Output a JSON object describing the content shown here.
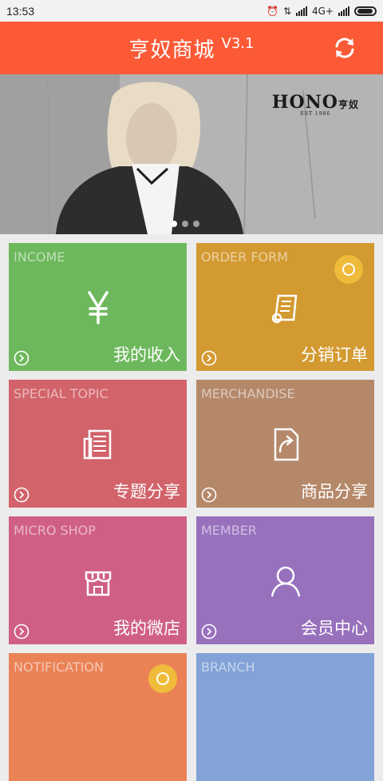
{
  "status_bar": {
    "time": "13:53",
    "network": "4G+"
  },
  "app_bar": {
    "title": "亨奴商城",
    "version": "V3.1"
  },
  "banner": {
    "brand": "HONO",
    "brand_cn": "亨奴",
    "est": "EST 1986",
    "slide_count": 3,
    "active_slide": 1
  },
  "tiles": [
    {
      "en": "INCOME",
      "cn": "我的收入",
      "color": "#6db85c",
      "icon": "yen-icon"
    },
    {
      "en": "ORDER FORM",
      "cn": "分销订单",
      "color": "#d39a31",
      "icon": "receipt-icon"
    },
    {
      "en": "SPECIAL TOPIC",
      "cn": "专题分享",
      "color": "#d2636a",
      "icon": "document-icon"
    },
    {
      "en": "MERCHANDISE",
      "cn": "商品分享",
      "color": "#b5886a",
      "icon": "share-icon"
    },
    {
      "en": "MICRO SHOP",
      "cn": "我的微店",
      "color": "#d05f85",
      "icon": "shop-icon"
    },
    {
      "en": "MEMBER",
      "cn": "会员中心",
      "color": "#9871bd",
      "icon": "person-icon"
    },
    {
      "en": "NOTIFICATION",
      "cn": "",
      "color": "#ea8256",
      "icon": "bell-icon"
    },
    {
      "en": "BRANCH",
      "cn": "",
      "color": "#82a2d8",
      "icon": "branch-icon"
    }
  ]
}
